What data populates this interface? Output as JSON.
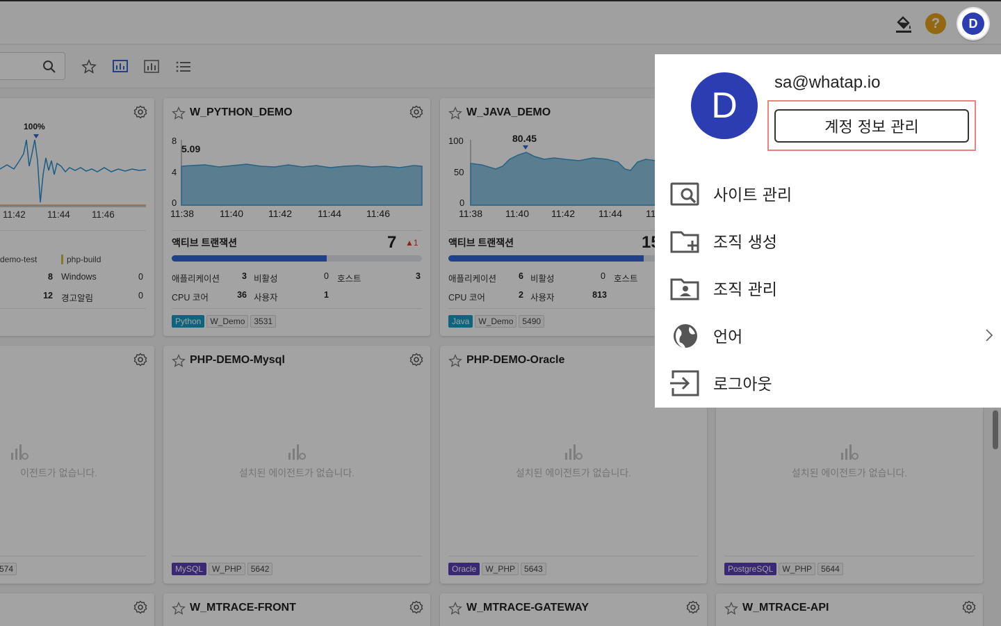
{
  "header": {
    "icons": [
      "paint-bucket-icon",
      "help-icon",
      "user-avatar"
    ],
    "help_label": "?",
    "avatar_initial": "D"
  },
  "toolbar": {
    "search_placeholder": "",
    "icons": [
      "star-icon",
      "bar-chart-icon",
      "column-chart-icon",
      "list-icon"
    ]
  },
  "cards": {
    "c0": {
      "peak": "100%",
      "x_ticks": [
        "11:42",
        "11:44",
        "11:46"
      ],
      "legend": [
        "demo-test",
        "php-build"
      ],
      "stats": [
        [
          "",
          "8",
          "Windows",
          "0"
        ],
        [
          "",
          "12",
          "경고알림",
          "0"
        ]
      ]
    },
    "c1": {
      "title": "W_PYTHON_DEMO",
      "y_ticks": [
        "8",
        "4",
        "0"
      ],
      "peak": "5.09",
      "x_ticks": [
        "11:38",
        "11:40",
        "11:42",
        "11:44",
        "11:46"
      ],
      "section": "액티브 트랜잭션",
      "count": "7",
      "delta": "▲1",
      "progress": 0.62,
      "stats": {
        "r1": [
          "애플리케이션",
          "3",
          "비활성",
          "0",
          "호스트",
          "3"
        ],
        "r2": [
          "CPU 코어",
          "36",
          "사용자",
          "1"
        ]
      },
      "tags": [
        "Python",
        "W_Demo",
        "3531"
      ],
      "lang_color": "#1a9cc4"
    },
    "c2": {
      "title": "W_JAVA_DEMO",
      "y_ticks": [
        "100",
        "50",
        "0"
      ],
      "peak": "80.45",
      "x_ticks": [
        "11:38",
        "11:40",
        "11:42",
        "11:44",
        "11"
      ],
      "section": "액티브 트랜잭션",
      "count": "15",
      "progress": 0.78,
      "stats": {
        "r1": [
          "애플리케이션",
          "6",
          "비활성",
          "0",
          "호스트"
        ],
        "r2": [
          "CPU 코어",
          "2",
          "사용자",
          "813"
        ]
      },
      "tags": [
        "Java",
        "W_Demo",
        "5490"
      ],
      "lang_color": "#1a9cc4"
    },
    "c3": {
      "empty": "이전트가 없습니다.",
      "tags": [
        "574"
      ]
    },
    "c4": {
      "title": "PHP-DEMO-Mysql",
      "empty": "설치된 에이전트가 없습니다.",
      "tags": [
        "MySQL",
        "W_PHP",
        "5642"
      ],
      "lang_color": "#5b3fb8"
    },
    "c5": {
      "title": "PHP-DEMO-Oracle",
      "empty": "설치된 에이전트가 없습니다.",
      "tags": [
        "Oracle",
        "W_PHP",
        "5643"
      ],
      "lang_color": "#5b3fb8"
    },
    "c6": {
      "empty": "설치된 에이전트가 없습니다.",
      "tags": [
        "PostgreSQL",
        "W_PHP",
        "5644"
      ],
      "lang_color": "#5b3fb8"
    },
    "c7": {
      "title": "W_MTRACE-FRONT"
    },
    "c8": {
      "title": "W_MTRACE-GATEWAY"
    },
    "c9": {
      "title": "W_MTRACE-API"
    }
  },
  "panel": {
    "avatar_initial": "D",
    "email": "sa@whatap.io",
    "account_button": "계정 정보 관리",
    "menu": [
      {
        "label": "사이트 관리",
        "icon": "site-search-icon"
      },
      {
        "label": "조직 생성",
        "icon": "folder-add-icon"
      },
      {
        "label": "조직 관리",
        "icon": "folder-user-icon"
      },
      {
        "label": "언어",
        "icon": "globe-icon"
      },
      {
        "label": "로그아웃",
        "icon": "logout-icon"
      }
    ]
  },
  "colors": {
    "brand": "#2c3db2",
    "highlight": "#f08080",
    "progress": "#2f66d6",
    "help": "#e8a31a"
  }
}
